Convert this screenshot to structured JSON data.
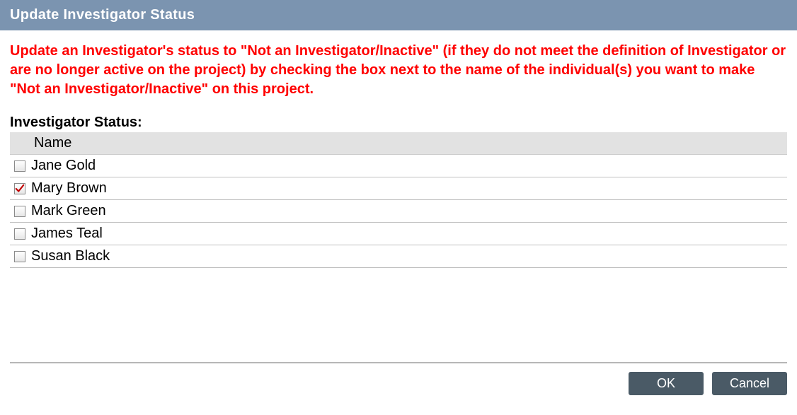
{
  "header": {
    "title": "Update Investigator Status"
  },
  "instructions": "Update an Investigator's status to \"Not an Investigator/Inactive\" (if they do not meet the definition of Investigator or are no longer active on the project) by checking the box next to the name of the individual(s) you want to make \"Not an Investigator/Inactive\" on this project.",
  "section_label": "Investigator Status:",
  "list": {
    "column_header": "Name",
    "rows": [
      {
        "name": "Jane Gold",
        "checked": false
      },
      {
        "name": "Mary Brown",
        "checked": true
      },
      {
        "name": "Mark Green",
        "checked": false
      },
      {
        "name": "James Teal",
        "checked": false
      },
      {
        "name": "Susan Black",
        "checked": false
      }
    ]
  },
  "buttons": {
    "ok": "OK",
    "cancel": "Cancel"
  },
  "colors": {
    "header_bg": "#7b94b0",
    "instruction_text": "#ff0000",
    "button_bg": "#4a5a66",
    "check_mark": "#c00000"
  }
}
